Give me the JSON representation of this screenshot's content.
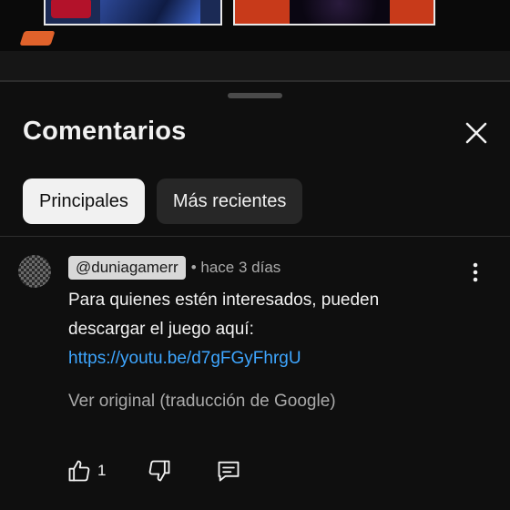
{
  "sheet": {
    "title": "Comentarios",
    "close_icon": "close-icon"
  },
  "chips": [
    {
      "label": "Principales",
      "selected": true
    },
    {
      "label": "Más recientes",
      "selected": false
    }
  ],
  "comment": {
    "author": "@duniagamerr",
    "separator": "•",
    "time": "hace 3 días",
    "text": "Para quienes estén interesados, pueden descargar el juego aquí:",
    "link": "https://youtu.be/d7gFGyFhrgU",
    "translate_label": "Ver original (traducción de Google)",
    "like_count": "1",
    "icons": {
      "like": "thumbs-up-icon",
      "dislike": "thumbs-down-icon",
      "reply": "reply-comment-icon",
      "menu": "more-vert-icon"
    }
  },
  "colors": {
    "background": "#0f0f0f",
    "text": "#f1f1f1",
    "muted": "#aaaaaa",
    "link": "#3ea6ff",
    "chip_active": "#f1f1f1",
    "chip_inactive": "#272727"
  }
}
